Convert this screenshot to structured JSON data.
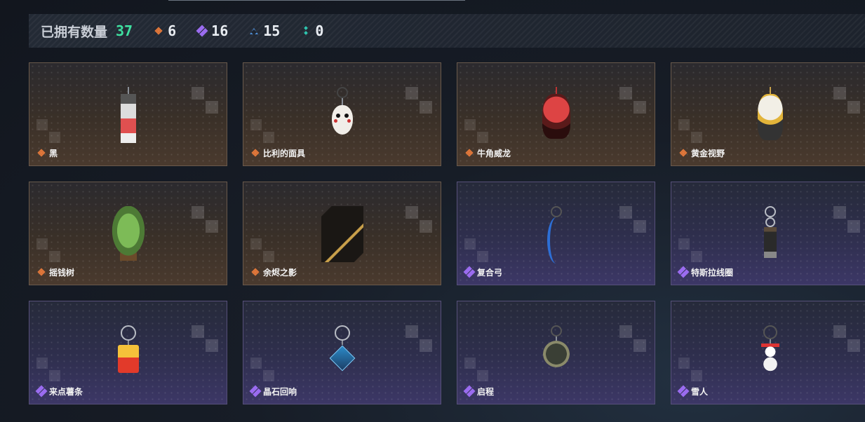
{
  "summary": {
    "owned_label": "已拥有数量",
    "owned_count": "37",
    "stats": [
      {
        "icon": "orange-diamond-icon",
        "value": "6"
      },
      {
        "icon": "purple-diamond-icon",
        "value": "16"
      },
      {
        "icon": "blue-triangle-icon",
        "value": "15"
      },
      {
        "icon": "teal-dots-icon",
        "value": "0"
      }
    ]
  },
  "items": [
    {
      "name": "黑",
      "rarity": "orange",
      "charm": "black-white-block-charm"
    },
    {
      "name": "比利的面具",
      "rarity": "orange",
      "charm": "billy-mask-charm"
    },
    {
      "name": "牛角威龙",
      "rarity": "orange",
      "charm": "red-horned-figure-charm"
    },
    {
      "name": "黄金视野",
      "rarity": "orange",
      "charm": "golden-vision-figure-charm"
    },
    {
      "name": "摇钱树",
      "rarity": "orange",
      "charm": "money-tree-charm"
    },
    {
      "name": "余烬之影",
      "rarity": "orange",
      "charm": "ember-shadow-charm"
    },
    {
      "name": "复合弓",
      "rarity": "purple",
      "charm": "compound-bow-charm"
    },
    {
      "name": "特斯拉线圈",
      "rarity": "purple",
      "charm": "tesla-coil-charm"
    },
    {
      "name": "来点薯条",
      "rarity": "purple",
      "charm": "fries-charm"
    },
    {
      "name": "晶石回响",
      "rarity": "purple",
      "charm": "crystal-echo-charm"
    },
    {
      "name": "启程",
      "rarity": "purple",
      "charm": "departure-medal-charm"
    },
    {
      "name": "雪人",
      "rarity": "purple",
      "charm": "snowman-charm"
    }
  ]
}
